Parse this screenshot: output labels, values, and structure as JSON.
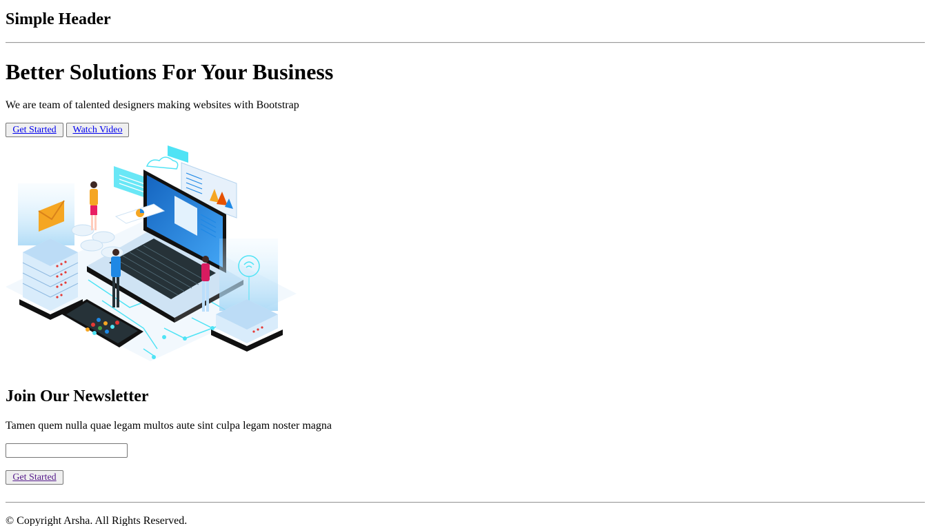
{
  "header": {
    "title": "Simple Header"
  },
  "hero": {
    "title": "Better Solutions For Your Business",
    "subtitle": "We are team of talented designers making websites with Bootstrap",
    "get_started_label": "Get Started",
    "watch_video_label": "Watch Video",
    "image": "isometric-laptop-servers-illustration"
  },
  "newsletter": {
    "title": "Join Our Newsletter",
    "text": "Tamen quem nulla quae legam multos aute sint culpa legam noster magna",
    "email_value": "",
    "submit_label": "Get Started"
  },
  "footer": {
    "copyright": "© Copyright Arsha. All Rights Reserved."
  },
  "colors": {
    "link": "#0000ee",
    "visited_link": "#551a8b",
    "accent_blue": "#1e88e5",
    "accent_cyan": "#4fe3f5",
    "accent_orange": "#f5a623"
  }
}
